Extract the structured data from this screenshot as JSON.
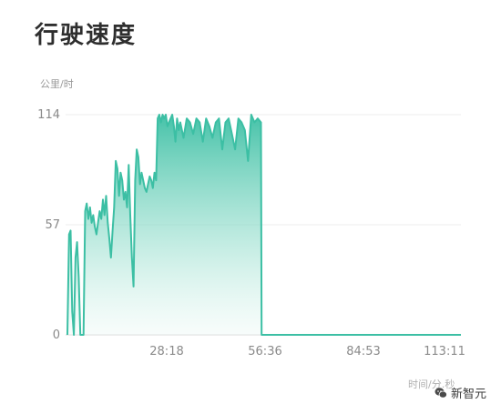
{
  "title": "行驶速度",
  "chart_data": {
    "type": "area",
    "y_unit": "公里/时",
    "x_unit": "时间/分.秒",
    "y_ticks": [
      "0",
      "57",
      "114"
    ],
    "x_ticks": [
      "28:18",
      "56:36",
      "84:53",
      "113:11"
    ],
    "ylim": [
      0,
      114
    ],
    "x_range_minutes": [
      0,
      122
    ],
    "grid": "horizontal",
    "color": "#3cbfa4",
    "series": [
      {
        "x": [
          0,
          0.5,
          1,
          1.5,
          2,
          2.5,
          3,
          3.5,
          4,
          4.5,
          5,
          5.5,
          6,
          6.5,
          7,
          7.5,
          8,
          8.5,
          9,
          9.5,
          10,
          10.5,
          11,
          11.5,
          12,
          12.5,
          13,
          13.5,
          14,
          14.5,
          15,
          15.5,
          16,
          16.5,
          17,
          17.5,
          18,
          18.5,
          19,
          19.5,
          20,
          20.5,
          21,
          21.5,
          22,
          22.5,
          23,
          23.5,
          24,
          24.5,
          25,
          25.5,
          26,
          26.5,
          27,
          27.5,
          28,
          28.5,
          29,
          29.5,
          30,
          30.5,
          31,
          31.5,
          32,
          32.5,
          33,
          33.5,
          34,
          34.5,
          35,
          36,
          37,
          38,
          39,
          40,
          41,
          42,
          43,
          44,
          45,
          46,
          47,
          48,
          49,
          50,
          51,
          52,
          53,
          54,
          55,
          56,
          57,
          58,
          59,
          60,
          60.2,
          61,
          122
        ],
        "y": [
          0,
          52,
          54,
          12,
          0,
          40,
          48,
          30,
          0,
          0,
          0,
          64,
          68,
          60,
          66,
          58,
          62,
          56,
          52,
          58,
          64,
          60,
          70,
          62,
          72,
          58,
          50,
          40,
          54,
          66,
          90,
          86,
          72,
          84,
          80,
          70,
          74,
          66,
          88,
          62,
          40,
          25,
          80,
          96,
          92,
          78,
          84,
          80,
          76,
          74,
          78,
          82,
          80,
          76,
          84,
          80,
          112,
          114,
          110,
          114,
          112,
          114,
          108,
          110,
          112,
          114,
          108,
          100,
          112,
          106,
          110,
          102,
          112,
          110,
          104,
          112,
          110,
          100,
          112,
          108,
          102,
          110,
          112,
          96,
          110,
          112,
          104,
          96,
          112,
          110,
          106,
          90,
          114,
          110,
          112,
          110,
          0,
          0,
          0
        ]
      }
    ]
  },
  "watermark": {
    "text": "新智元",
    "icon": "wechat-icon"
  }
}
